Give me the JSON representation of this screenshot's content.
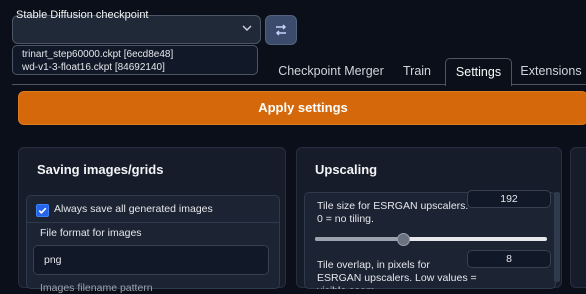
{
  "checkpoint": {
    "label": "Stable Diffusion checkpoint",
    "options": [
      "trinart_step60000.ckpt [6ecd8e48]",
      "wd-v1-3-float16.ckpt [84692140]"
    ]
  },
  "tabs": [
    "Checkpoint Merger",
    "Train",
    "Settings",
    "Extensions"
  ],
  "active_tab": "Settings",
  "apply_label": "Apply settings",
  "saving": {
    "title": "Saving images/grids",
    "always_save_label": "Always save all generated images",
    "always_save_checked": true,
    "format_label": "File format for images",
    "format_value": "png",
    "cut_label": "Images filename pattern"
  },
  "upscaling": {
    "title": "Upscaling",
    "tile_size_label": "Tile size for ESRGAN upscalers. 0 = no tiling.",
    "tile_size_value": "192",
    "tile_size_fraction": 0.38,
    "overlap_label": "Tile overlap, in pixels for ESRGAN upscalers. Low values = visible seam.",
    "overlap_value": "8"
  },
  "colors": {
    "accent": "#d4680a",
    "checkbox": "#2563eb",
    "background": "#0b0f19"
  }
}
